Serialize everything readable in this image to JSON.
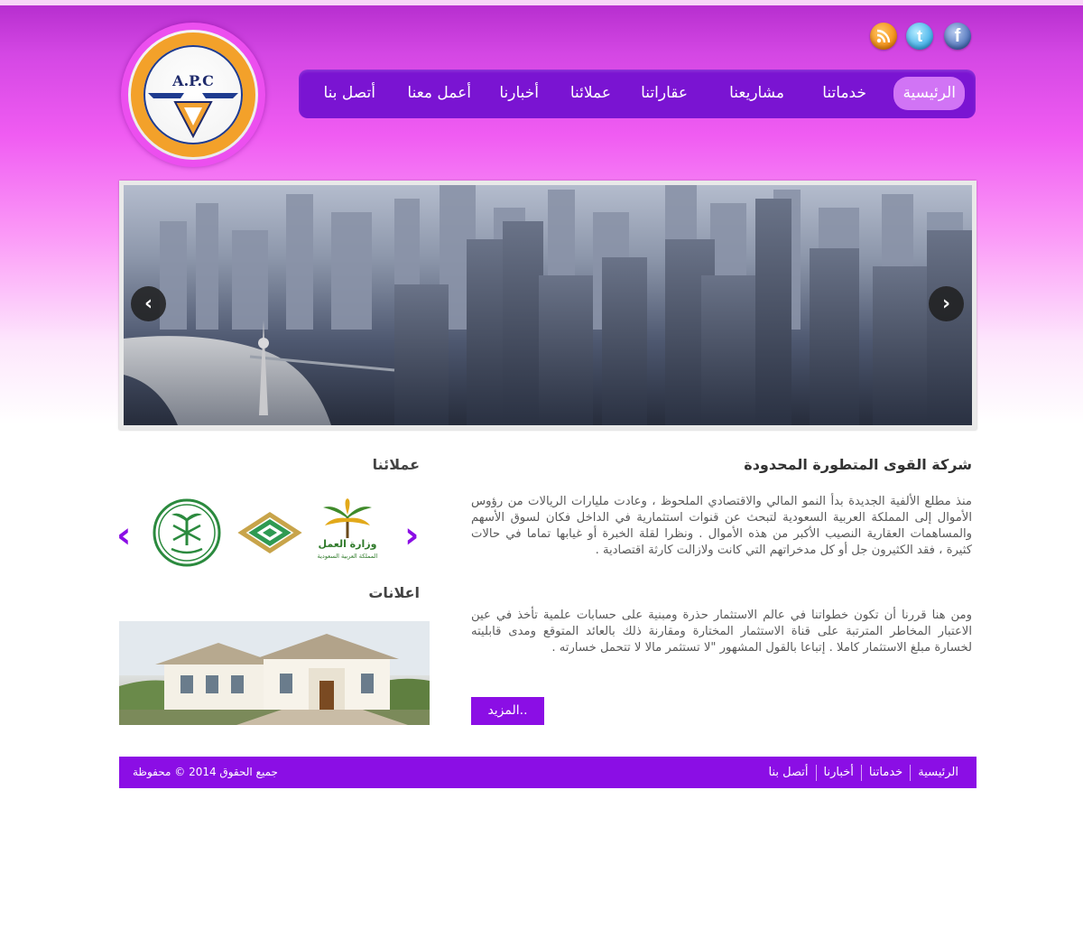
{
  "brand": {
    "logo_text": "A.P.C",
    "logo_ring_text": "شركة القوى المتطورة المحدودة"
  },
  "social": [
    {
      "name": "rss",
      "icon": "rss-icon"
    },
    {
      "name": "twitter",
      "icon": "twitter-icon"
    },
    {
      "name": "facebook",
      "icon": "facebook-icon"
    }
  ],
  "nav": {
    "items": [
      {
        "label": "الرئيسية",
        "active": true
      },
      {
        "label": "خدماتنا"
      },
      {
        "label": "مشاريعنا"
      },
      {
        "label": "عقاراتنا"
      },
      {
        "label": "عملائنا"
      },
      {
        "label": "أخبارنا"
      },
      {
        "label": "أعمل معنا"
      },
      {
        "label": "أتصل بنا"
      }
    ]
  },
  "slider": {
    "prev_icon": "chevron-left-icon",
    "next_icon": "chevron-right-icon"
  },
  "article": {
    "title": "شركة القوى المتطورة المحدودة",
    "paragraph1": "منذ مطلع الألفية الجديدة بدأ النمو المالي والاقتصادي الملحوظ ، وعادت مليارات الريالات من رؤوس الأموال إلى المملكة العربية السعودية لتبحث عن قنوات استثمارية في الداخل فكان لسوق الأسهم والمساهمات العقارية النصيب الأكبر من هذه الأموال . ونظرا لقلة الخبرة أو غيابها تماما في حالات كثيرة ، فقد الكثيرون جل أو كل مدخراتهم التي كانت ولازالت كارثة اقتصادية .",
    "paragraph2": "ومن هنا قررنا أن تكون خطواتنا في عالم الاستثمار حذرة ومبنية على حسابات علمية تأخذ في عين الاعتبار المخاطر المترتبة على قناة الاستثمار المختارة ومقارنة ذلك بالعائد المتوقع ومدى قابليته لخسارة مبلغ الاستثمار كاملا . إتباعا بالقول المشهور \"لا تستثمر مالا لا تتحمل خسارته .",
    "more_label": "المزيد.."
  },
  "sidebar": {
    "clients_title": "عملائنا",
    "clients": [
      {
        "name": "وزارة العمل",
        "subtitle": "المملكة العربية السعودية"
      },
      {
        "name": "client-logo-2"
      },
      {
        "name": "client-logo-3"
      }
    ],
    "ads_title": "اعلانات"
  },
  "footer": {
    "links": [
      "الرئيسية",
      "خدماتنا",
      "أخبارنا",
      "أتصل بنا"
    ],
    "copyright": "جميع الحقوق 2014 © محفوظة"
  },
  "colors": {
    "accent": "#8b0ee5",
    "nav": "#7a14d2",
    "nav_active": "#d174f5",
    "header_pink": "#f05cf2"
  }
}
